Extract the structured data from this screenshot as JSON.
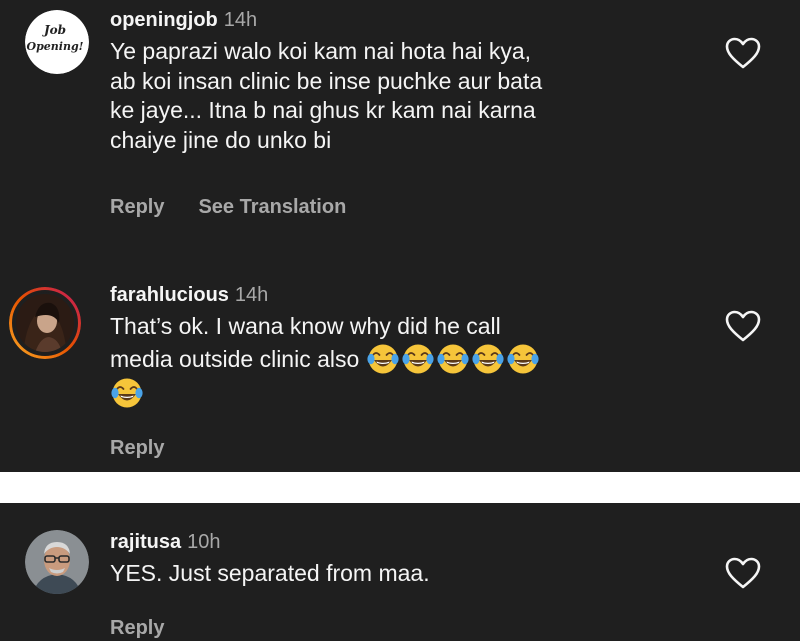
{
  "comments": [
    {
      "username": "openingjob",
      "time": "14h",
      "avatar_lines": [
        "Job",
        "Opening!"
      ],
      "lines": [
        "Ye paprazi walo koi kam nai hota hai kya,",
        "ab koi insan clinic be inse puchke aur bata",
        "ke jaye... Itna b nai ghus kr kam nai karna",
        "chaiye jine do unko bi"
      ],
      "reply_label": "Reply",
      "translation_label": "See Translation"
    },
    {
      "username": "farahlucious",
      "time": "14h",
      "lines": [
        "That’s ok. I wana know why did he call",
        "media outside clinic also"
      ],
      "emojis": [
        "face-with-tears-of-joy",
        "face-with-tears-of-joy",
        "face-with-tears-of-joy",
        "face-with-tears-of-joy",
        "face-with-tears-of-joy",
        "face-with-tears-of-joy"
      ],
      "reply_label": "Reply"
    },
    {
      "username": "rajitusa",
      "time": "10h",
      "lines": [
        "YES. Just separated from maa."
      ],
      "reply_label": "Reply"
    }
  ],
  "icons": {
    "like": "heart-outline-icon"
  },
  "colors": {
    "background": "#1f1f1f",
    "text": "#f5f5f5",
    "secondary": "#a8a8a8",
    "divider": "#ffffff"
  }
}
